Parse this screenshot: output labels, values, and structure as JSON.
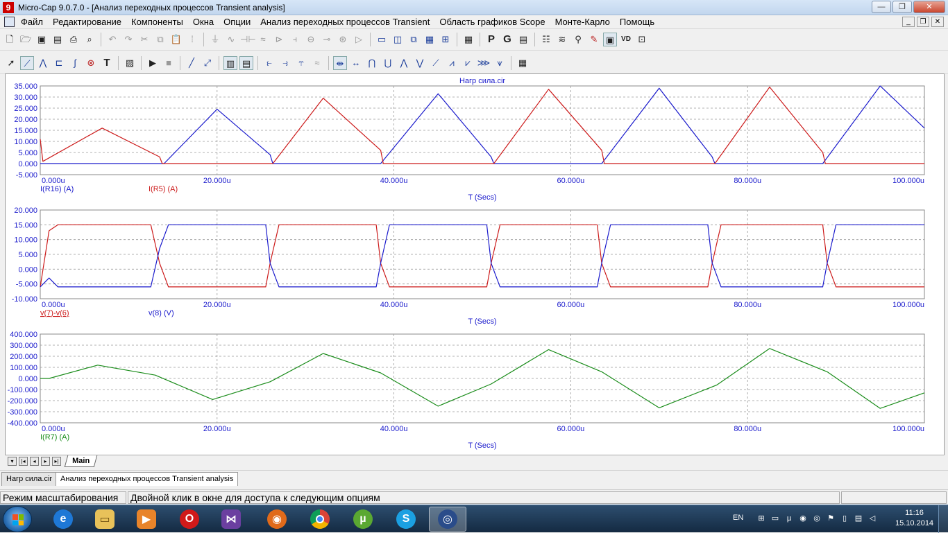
{
  "window": {
    "title": "Micro-Cap 9.0.7.0 - [Анализ переходных процессов Transient analysis]",
    "app_icon": "9",
    "min": "—",
    "max": "❐",
    "close": "✕"
  },
  "menu": {
    "items": [
      "Файл",
      "Редактирование",
      "Компоненты",
      "Окна",
      "Опции",
      "Анализ переходных процессов Transient",
      "Область графиков Scope",
      "Монте-Карло",
      "Помощь"
    ],
    "mdi": [
      "_",
      "❐",
      "✕"
    ]
  },
  "toolbar1": {
    "icons": [
      "new-icon",
      "open-icon",
      "save-icon",
      "save-all-icon",
      "print-icon",
      "print-preview-icon",
      "undo-icon",
      "redo-icon",
      "cut-icon",
      "copy-icon",
      "paste-icon",
      "select-all-icon",
      "ground-icon",
      "resistor-icon",
      "capacitor-icon",
      "inductor-icon",
      "diode-icon",
      "battery-icon",
      "voltage-source-icon",
      "npn-icon",
      "transistor-icon",
      "opamp-icon",
      "plot-layout-1-icon",
      "plot-layout-2-icon",
      "plot-layout-3-icon",
      "plot-layout-4-icon",
      "plot-layout-5-icon",
      "calculator-icon",
      "p-icon",
      "g-icon",
      "properties-icon",
      "numeric-output-icon",
      "waveform-icon",
      "probe-icon",
      "pen-icon",
      "zoom-window-icon",
      "vd-icon",
      "graph-icon"
    ],
    "p_label": "P",
    "g_label": "G",
    "vd_label": "VD"
  },
  "toolbar2": {
    "text_tool": "T"
  },
  "plot": {
    "title": "Нагр сила.cir",
    "xticks": [
      "0.000u",
      "20.000u",
      "40.000u",
      "60.000u",
      "80.000u",
      "100.000u"
    ],
    "xlabel": "T (Secs)",
    "panels": [
      {
        "yticks": [
          "35.000",
          "30.000",
          "25.000",
          "20.000",
          "15.000",
          "10.000",
          "5.000",
          "0.000",
          "-5.000"
        ],
        "ymin": -5,
        "ymax": 35,
        "legend": [
          {
            "label": "I(R16) (A)",
            "color": "#1a1acc"
          },
          {
            "label": "I(R5) (A)",
            "color": "#cc1a1a"
          }
        ]
      },
      {
        "yticks": [
          "20.000",
          "15.000",
          "10.000",
          "5.000",
          "0.000",
          "-5.000",
          "-10.000"
        ],
        "ymin": -10,
        "ymax": 20,
        "legend": [
          {
            "label": "v(7)-v(6)",
            "color": "#cc1a1a"
          },
          {
            "label": "v(8) (V)",
            "color": "#1a1acc"
          }
        ]
      },
      {
        "yticks": [
          "400.000",
          "300.000",
          "200.000",
          "100.000",
          "0.000",
          "-100.000",
          "-200.000",
          "-300.000",
          "-400.000"
        ],
        "ymin": -400,
        "ymax": 400,
        "legend": [
          {
            "label": "I(R7) (A)",
            "color": "#1a8c1a"
          }
        ]
      }
    ]
  },
  "chart_data": [
    {
      "type": "line",
      "title": "Нагр сила.cir",
      "xlabel": "T (Secs)",
      "ylabel": "",
      "xlim": [
        0,
        100
      ],
      "ylim": [
        -5,
        35
      ],
      "series": [
        {
          "name": "I(R16) (A)",
          "color": "#1a1acc",
          "x": [
            0,
            13.5,
            14,
            20,
            26,
            26.3,
            38.5,
            45,
            51,
            51.3,
            63.5,
            70,
            76,
            76.3,
            88.5,
            95,
            100
          ],
          "y": [
            0,
            0,
            0,
            24.5,
            4,
            0,
            0,
            31.5,
            3,
            0,
            0,
            34,
            3,
            0,
            0,
            35,
            16
          ]
        },
        {
          "name": "I(R5) (A)",
          "color": "#cc1a1a",
          "x": [
            0,
            0.3,
            7,
            13.5,
            13.8,
            26.3,
            32,
            38.5,
            38.8,
            51.3,
            57.5,
            63.5,
            63.8,
            76.3,
            82.5,
            88.5,
            88.8,
            100
          ],
          "y": [
            11,
            1,
            16,
            3,
            0,
            0,
            29.5,
            6,
            0,
            0,
            33.5,
            6,
            0,
            0,
            34.5,
            5,
            0,
            0
          ]
        }
      ]
    },
    {
      "type": "line",
      "xlabel": "T (Secs)",
      "ylabel": "",
      "xlim": [
        0,
        100
      ],
      "ylim": [
        -10,
        20
      ],
      "series": [
        {
          "name": "v(7)-v(6)",
          "color": "#cc1a1a",
          "x": [
            0,
            1,
            2,
            12.5,
            13.5,
            14.5,
            25.5,
            26,
            27,
            38,
            38.5,
            39.5,
            50.5,
            51,
            52,
            63,
            63.5,
            64.5,
            75.5,
            76,
            77,
            88.5,
            89,
            90,
            100
          ],
          "y": [
            -6,
            13,
            15,
            15,
            2,
            -6,
            -6,
            2,
            15,
            15,
            2,
            -6,
            -6,
            2,
            15,
            15,
            2,
            -6,
            -6,
            2,
            15,
            15,
            2,
            -6,
            -6
          ]
        },
        {
          "name": "v(8) (V)",
          "color": "#1a1acc",
          "x": [
            0,
            1,
            2,
            12.5,
            13.5,
            14.5,
            25.5,
            26,
            27,
            38,
            38.5,
            39.5,
            50.5,
            51,
            52,
            63,
            63.5,
            64.5,
            75.5,
            76,
            77,
            88.5,
            89,
            90,
            100
          ],
          "y": [
            -6,
            -3,
            -6,
            -6,
            7,
            15,
            15,
            2,
            -6,
            -6,
            2,
            15,
            15,
            2,
            -6,
            -6,
            2,
            15,
            15,
            2,
            -6,
            -6,
            2,
            15,
            15
          ]
        }
      ]
    },
    {
      "type": "line",
      "xlabel": "T (Secs)",
      "ylabel": "",
      "xlim": [
        0,
        100
      ],
      "ylim": [
        -400,
        400
      ],
      "series": [
        {
          "name": "I(R7) (A)",
          "color": "#1a8c1a",
          "x": [
            0,
            1,
            6.5,
            13,
            19.5,
            26,
            32,
            38.5,
            45,
            51,
            57.5,
            63.5,
            70,
            76.5,
            82.5,
            89,
            95,
            100
          ],
          "y": [
            0,
            0,
            120,
            30,
            -190,
            -30,
            225,
            50,
            -250,
            -50,
            260,
            60,
            -265,
            -60,
            270,
            60,
            -270,
            -130
          ]
        }
      ]
    }
  ],
  "sheet_tab": "Main",
  "doc_tabs": [
    "Нагр сила.cir",
    "Анализ переходных процессов Transient analysis"
  ],
  "status": [
    "Режим масштабирования",
    "Двойной клик в окне для доступа к следующим опциям"
  ],
  "taskbar": {
    "apps": [
      "internet-explorer-icon",
      "file-explorer-icon",
      "media-player-icon",
      "opera-icon",
      "visual-studio-icon",
      "firefox-icon",
      "chrome-icon",
      "utorrent-icon",
      "skype-icon",
      "microcap-icon"
    ],
    "lang": "EN",
    "time": "11:16",
    "date": "15.10.2014"
  }
}
